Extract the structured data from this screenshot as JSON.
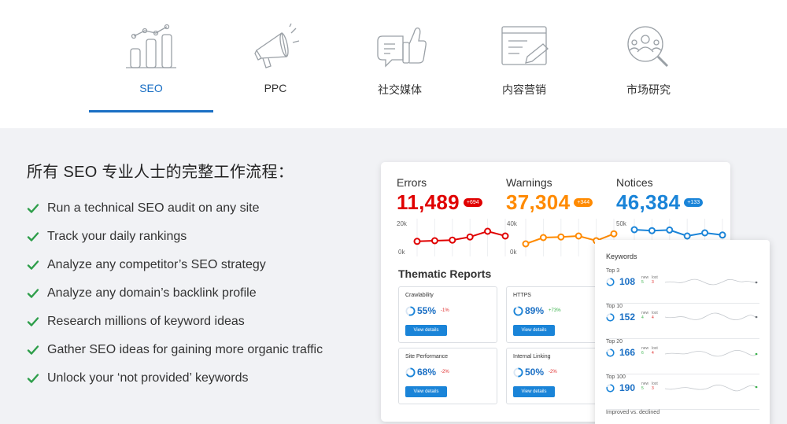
{
  "tabs": [
    {
      "label": "SEO",
      "icon": "bar-chart-icon",
      "active": true
    },
    {
      "label": "PPC",
      "icon": "megaphone-icon",
      "active": false
    },
    {
      "label": "社交媒体",
      "icon": "thumbs-up-icon",
      "active": false
    },
    {
      "label": "内容营销",
      "icon": "document-pen-icon",
      "active": false
    },
    {
      "label": "市场研究",
      "icon": "audience-search-icon",
      "active": false
    }
  ],
  "features": {
    "heading": "所有 SEO 专业人士的完整工作流程：",
    "items": [
      "Run a technical SEO audit on any site",
      "Track your daily rankings",
      "Analyze any competitor’s SEO strategy",
      "Analyze any domain’s backlink profile",
      "Research millions of keyword ideas",
      "Gather SEO ideas for gaining more organic traffic",
      "Unlock your ‘not provided’ keywords"
    ],
    "check_color": "#2e9e4a"
  },
  "dashboard": {
    "metrics": [
      {
        "name": "Errors",
        "value": "11,489",
        "badge": "+694",
        "color": "#e00000",
        "ymax": "20k",
        "ymin": "0k",
        "trend": [
          0.38,
          0.4,
          0.42,
          0.52,
          0.7,
          0.55
        ]
      },
      {
        "name": "Warnings",
        "value": "37,304",
        "badge": "+344",
        "color": "#ff8a00",
        "ymax": "40k",
        "ymin": "0k",
        "trend": [
          0.3,
          0.5,
          0.52,
          0.55,
          0.4,
          0.62
        ]
      },
      {
        "name": "Notices",
        "value": "46,384",
        "badge": "+133",
        "color": "#1a84d8",
        "ymax": "50k",
        "ymin": "",
        "trend": [
          0.75,
          0.72,
          0.74,
          0.55,
          0.65,
          0.58
        ]
      }
    ],
    "thematic_title": "Thematic Reports",
    "reports": [
      {
        "name": "Crawlability",
        "value": "55%",
        "delta": "-1%",
        "delta_color": "#e02d2d",
        "button": "View details",
        "pct": 55
      },
      {
        "name": "HTTPS",
        "value": "89%",
        "delta": "+73%",
        "delta_color": "#38b24a",
        "button": "View details",
        "pct": 89
      },
      {
        "name": "Site Performance",
        "value": "68%",
        "delta": "-2%",
        "delta_color": "#e02d2d",
        "button": "View details",
        "pct": 68
      },
      {
        "name": "Internal Linking",
        "value": "50%",
        "delta": "-2%",
        "delta_color": "#e02d2d",
        "button": "View details",
        "pct": 50
      }
    ]
  },
  "keywords": {
    "title": "Keywords",
    "rows": [
      {
        "label": "Top 3",
        "value": "108",
        "new_label": "new",
        "new": "5",
        "lost_label": "lost",
        "lost": "3",
        "pct": 70
      },
      {
        "label": "Top 10",
        "value": "152",
        "new_label": "new",
        "new": "4",
        "lost_label": "lost",
        "lost": "4",
        "pct": 75
      },
      {
        "label": "Top 20",
        "value": "166",
        "new_label": "new",
        "new": "6",
        "lost_label": "lost",
        "lost": "4",
        "pct": 78
      },
      {
        "label": "Top 100",
        "value": "190",
        "new_label": "new",
        "new": "5",
        "lost_label": "lost",
        "lost": "3",
        "pct": 80
      }
    ],
    "footer": "Improved vs. declined"
  }
}
